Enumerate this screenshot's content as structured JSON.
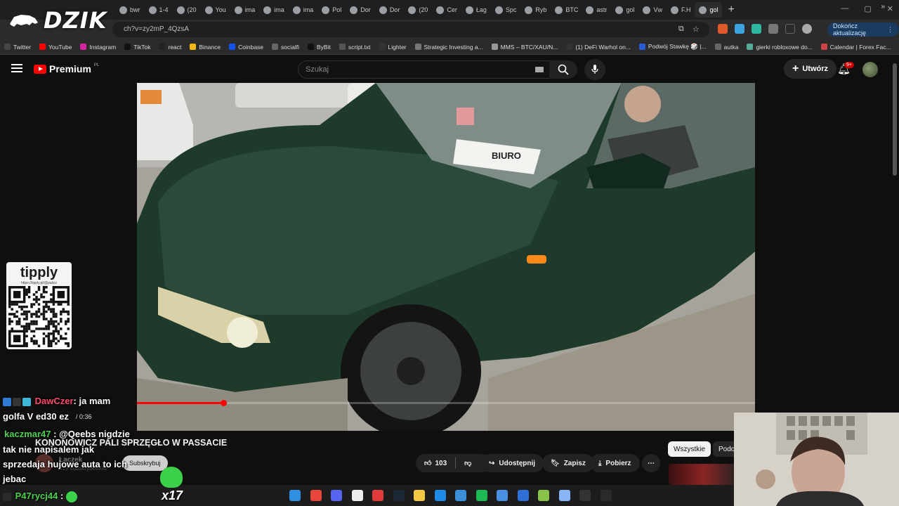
{
  "browser": {
    "tabs": [
      "bwr",
      "1-4",
      "(20",
      "You",
      "ima",
      "ima",
      "ima",
      "Pol",
      "Dor",
      "Dor",
      "(20",
      "Cer",
      "Łag",
      "Spc",
      "Ryb",
      "BTC",
      "astr",
      "gol",
      "Vw",
      "F.H",
      "gol"
    ],
    "active_tab_index": 20,
    "url": "ch?v=zy2mP_4QzsA",
    "update_button": "Dokończ aktualizację",
    "bookmarks": [
      "Twitter",
      "YouTube",
      "Instagram",
      "TikTok",
      "react",
      "Binance",
      "Coinbase",
      "socialfi",
      "ByBit",
      "script.txt",
      "Lighter",
      "Strategic Investing a...",
      "MMS – BTC/XAU/N...",
      "(1) DeFi Warhol on...",
      "Podwój Stawkę 🎲 |...",
      "autka",
      "gierki robloxowe do...",
      "Calendar | Forex Fac..."
    ]
  },
  "overlay": {
    "logo_text": "DZIK"
  },
  "youtube": {
    "brand": "Premium",
    "region": "PL",
    "search_placeholder": "Szukaj",
    "create_label": "Utwórz",
    "notif_badge": "9+",
    "video": {
      "title": "KONONOWICZ PALI SPRZĘGŁO W PASSACIE",
      "time": "/ 0:36",
      "progress": 0.14,
      "sign_text": "BIURO"
    },
    "channel": {
      "name": "Łaczek",
      "subs": "419 subskrybentów",
      "subscribe_label": "Subskrybuj"
    },
    "actions": {
      "likes": "103",
      "share": "Udostępnij",
      "save": "Zapisz",
      "download": "Pobierz"
    },
    "filters": [
      "Wszystkie",
      "Podo"
    ]
  },
  "tipply": {
    "brand": "tipply",
    "url": "https://tipply.pl/@patizz"
  },
  "chat": [
    {
      "user": "DawCzer",
      "color": "#ff4a6a",
      "text": ": ja mam"
    },
    {
      "user": "",
      "color": "#ffffff",
      "text": "golfa V ed30 ez"
    },
    {
      "user": "kaczmar47",
      "color": "#4cd24c",
      "text": ": @Qeebs nigdzie"
    },
    {
      "user": "",
      "color": "#ffffff",
      "text": "tak nie napisalem jak"
    },
    {
      "user": "",
      "color": "#ffffff",
      "text": "sprzedaja hujowe auta to ich"
    },
    {
      "user": "",
      "color": "#ffffff",
      "text": "jebac"
    },
    {
      "user": "P47rycj44",
      "color": "#4cd24c",
      "text": ":"
    }
  ],
  "emote_count": "x17",
  "colors": {
    "accent": "#ff0000",
    "background": "#0f0f0f"
  }
}
